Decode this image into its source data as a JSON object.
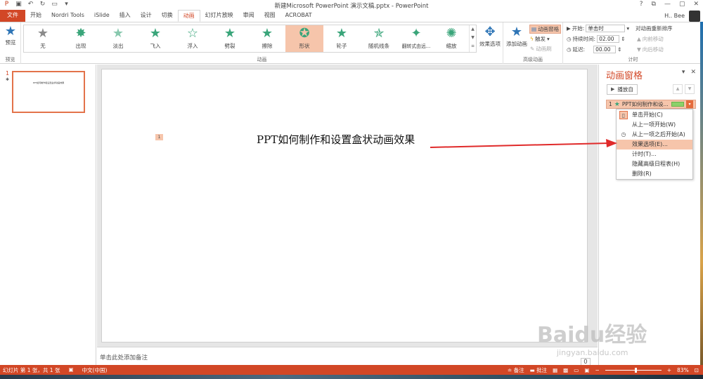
{
  "window": {
    "title": "新建Microsoft PowerPoint 演示文稿.pptx - PowerPoint",
    "controls": [
      "?",
      "⧉",
      "—",
      "▢",
      "✕"
    ]
  },
  "tabs": [
    "文件",
    "开始",
    "Nordri Tools",
    "iSlide",
    "插入",
    "设计",
    "切换",
    "动画",
    "幻灯片放映",
    "审阅",
    "视图",
    "ACROBAT"
  ],
  "user": {
    "name": "H.. Bee"
  },
  "ribbon": {
    "preview_label": "预览",
    "preview_group": "预览",
    "animation_group": "动画",
    "advanced_group": "高级动画",
    "timing_group": "计时",
    "gallery": [
      "无",
      "出现",
      "淡出",
      "飞入",
      "浮入",
      "劈裂",
      "擦除",
      "形状",
      "轮子",
      "随机线条",
      "翻转式由远...",
      "缩放"
    ],
    "effect_options": "效果选项",
    "add_animation": "添加动画",
    "anim_pane_btn": "动画窗格",
    "trigger_btn": "触发",
    "anim_painter": "动画刷",
    "start_label": "开始:",
    "start_value": "单击时",
    "duration_label": "持续时间:",
    "duration_value": "02.00",
    "delay_label": "延迟:",
    "delay_value": "00.00",
    "reorder_label": "对动画重新排序",
    "move_earlier": "向前移动",
    "move_later": "向后移动"
  },
  "thumbs": {
    "number": "1",
    "title_tiny": "PPT如何制作和设置盒状动画效果"
  },
  "slide": {
    "anim_tag": "1",
    "title": "PPT如何制作和设置盒状动画效果"
  },
  "notes": {
    "placeholder": "单击此处添加备注",
    "page_value": "0"
  },
  "pane": {
    "title": "动画窗格",
    "play_label": "播放自",
    "item_index": "1",
    "item_label": "PPT如何制作和设...",
    "menu": [
      {
        "label": "单击开始(C)"
      },
      {
        "label": "从上一项开始(W)"
      },
      {
        "label": "从上一项之后开始(A)"
      },
      {
        "label": "效果选项(E)..."
      },
      {
        "label": "计时(T)..."
      },
      {
        "label": "隐藏高级日程表(H)"
      },
      {
        "label": "删除(R)"
      }
    ]
  },
  "status": {
    "slide_info": "幻灯片 第 1 张，共 1 张",
    "language": "中文(中国)",
    "notes_btn": "备注",
    "comments_btn": "批注",
    "zoom": "83%",
    "zoom_fraction": 0.53
  },
  "watermark": {
    "logo": "Baidu经验",
    "url": "jingyan.baidu.com"
  },
  "colors": {
    "accent": "#d24726",
    "highlight": "#f6c5ab",
    "star_green": "#3aa57a",
    "arrow": "#e02a2a"
  }
}
